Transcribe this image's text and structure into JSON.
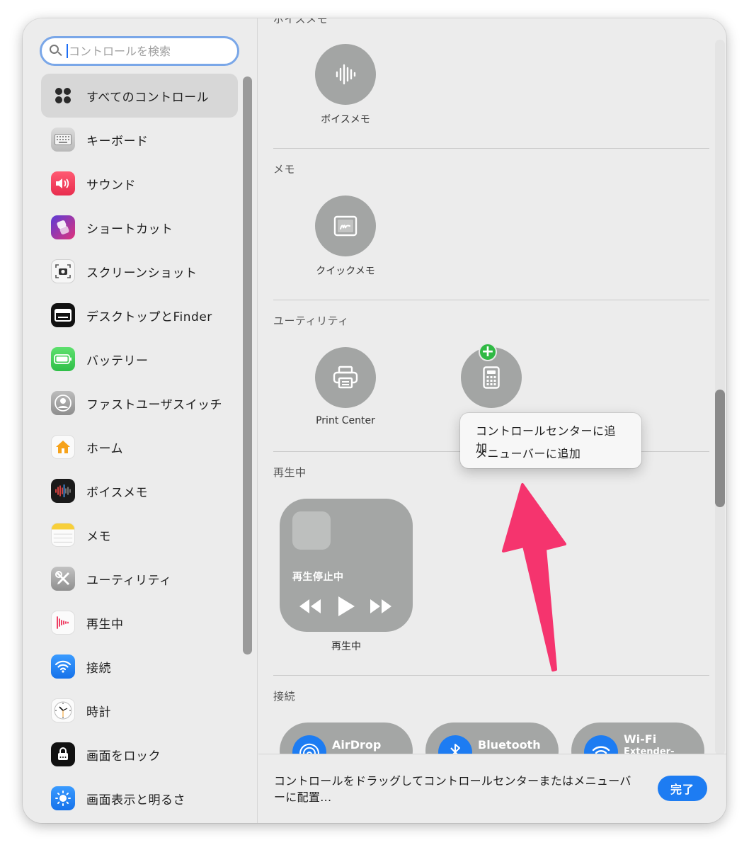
{
  "search": {
    "placeholder": "コントロールを検索"
  },
  "sidebar": {
    "items": [
      {
        "label": "すべてのコントロール",
        "icon": "grid-icon",
        "selected": true
      },
      {
        "label": "キーボード",
        "icon": "keyboard-icon"
      },
      {
        "label": "サウンド",
        "icon": "speaker-icon"
      },
      {
        "label": "ショートカット",
        "icon": "shortcuts-icon"
      },
      {
        "label": "スクリーンショット",
        "icon": "camera-icon"
      },
      {
        "label": "デスクトップとFinder",
        "icon": "desktop-icon"
      },
      {
        "label": "バッテリー",
        "icon": "battery-icon"
      },
      {
        "label": "ファストユーザスイッチ",
        "icon": "user-icon"
      },
      {
        "label": "ホーム",
        "icon": "home-icon"
      },
      {
        "label": "ボイスメモ",
        "icon": "voice-memo-icon"
      },
      {
        "label": "メモ",
        "icon": "notes-icon"
      },
      {
        "label": "ユーティリティ",
        "icon": "utilities-icon"
      },
      {
        "label": "再生中",
        "icon": "now-playing-icon"
      },
      {
        "label": "接続",
        "icon": "wifi-icon"
      },
      {
        "label": "時計",
        "icon": "clock-icon"
      },
      {
        "label": "画面をロック",
        "icon": "lock-icon"
      },
      {
        "label": "画面表示と明るさ",
        "icon": "brightness-icon"
      }
    ]
  },
  "main": {
    "voice_memo": {
      "title": "ボイスメモ",
      "control_label": "ボイスメモ"
    },
    "notes": {
      "title": "メモ",
      "control_label": "クイックメモ"
    },
    "utilities": {
      "title": "ユーティリティ",
      "print_label": "Print Center",
      "calculator_label": "計算機"
    },
    "now_playing": {
      "title": "再生中",
      "status": "再生停止中",
      "control_label": "再生中"
    },
    "connectivity": {
      "title": "接続",
      "items": [
        {
          "label": "AirDrop",
          "sub": ""
        },
        {
          "label": "Bluetooth",
          "sub": ""
        },
        {
          "label": "Wi-Fi",
          "sub": "Extender-"
        }
      ]
    }
  },
  "context_menu": {
    "items": [
      "コントロールセンターに追加",
      "メニューバーに追加"
    ]
  },
  "footer": {
    "instruction": "コントロールをドラッグしてコントロールセンターまたはメニューバーに配置...",
    "done_label": "完了"
  },
  "colors": {
    "accent": "#1d7cf2",
    "arrow": "#f5346e",
    "plus_badge": "#2fb944",
    "control_fill": "#a3a5a4"
  }
}
